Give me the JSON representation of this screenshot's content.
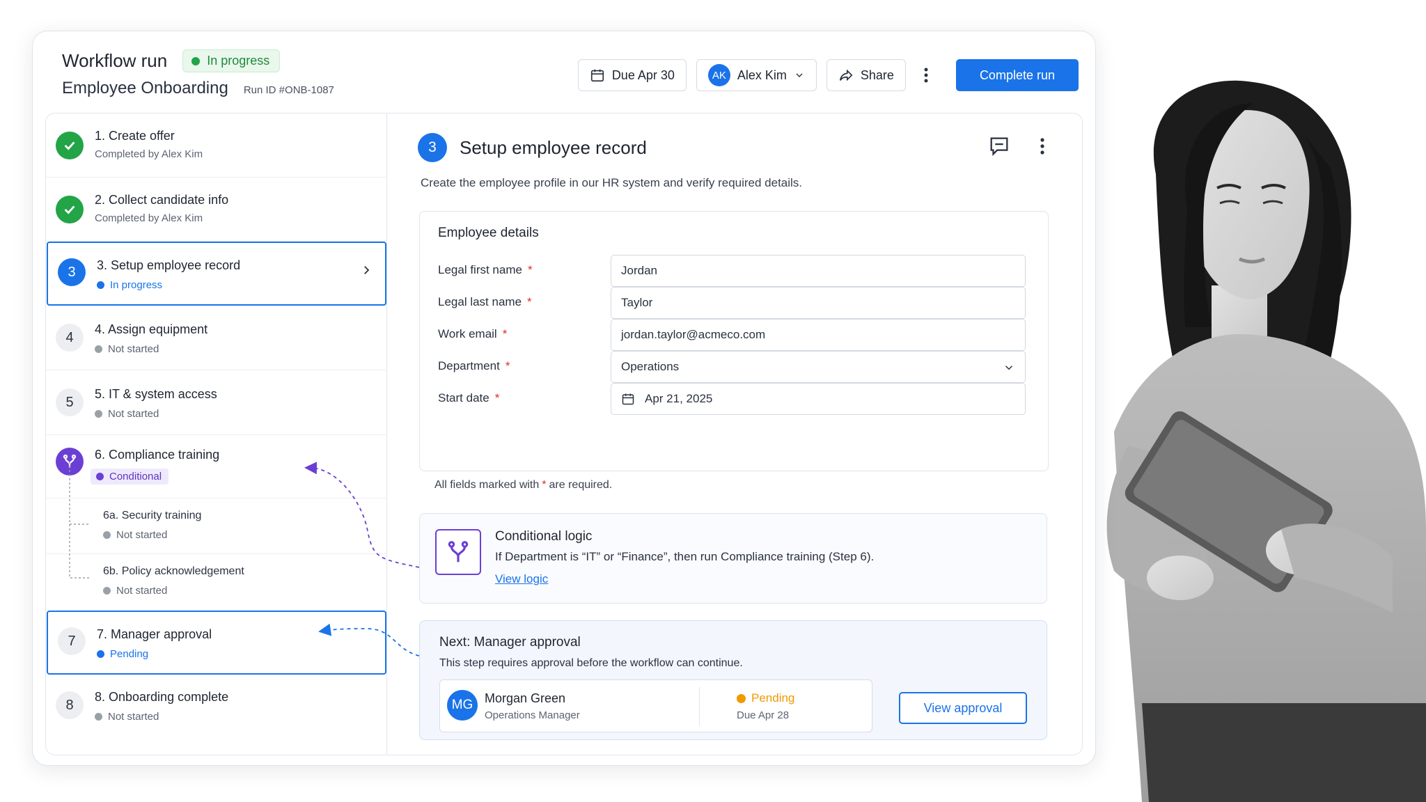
{
  "header": {
    "app_title": "Workflow run",
    "status": "In progress",
    "workflow_name": "Employee Onboarding",
    "run_id": "Run ID #ONB-1087",
    "due_label": "Due Apr 30",
    "assignee_initials": "AK",
    "assignee_name": "Alex Kim",
    "share_label": "Share",
    "complete_label": "Complete run"
  },
  "steps": [
    {
      "number": "1",
      "label": "1. Create offer",
      "meta": "Completed by Alex Kim",
      "state": "done"
    },
    {
      "number": "2",
      "label": "2. Collect candidate info",
      "meta": "Completed by Alex Kim",
      "state": "done"
    },
    {
      "number": "3",
      "label": "3. Setup employee record",
      "meta": "In progress",
      "state": "current"
    },
    {
      "number": "4",
      "label": "4. Assign equipment",
      "meta": "Not started",
      "state": "todo"
    },
    {
      "number": "5",
      "label": "5. IT & system access",
      "meta": "Not started",
      "state": "todo"
    },
    {
      "number": "6",
      "label": "6. Compliance training",
      "meta": "Conditional",
      "state": "conditional"
    },
    {
      "number": "7",
      "label": "7. Manager approval",
      "meta": "Pending",
      "state": "pending"
    },
    {
      "number": "8",
      "label": "8. Onboarding complete",
      "meta": "Not started",
      "state": "todo"
    }
  ],
  "sub_steps": [
    {
      "label": "6a. Security training",
      "meta": "Not started"
    },
    {
      "label": "6b. Policy acknowledgement",
      "meta": "Not started"
    }
  ],
  "main": {
    "step_number": "3",
    "title": "Setup employee record",
    "description": "Create the employee profile in our HR system and verify required details.",
    "card_title": "Employee details",
    "fields": [
      {
        "label": "Legal first name",
        "value": "Jordan"
      },
      {
        "label": "Legal last name",
        "value": "Taylor"
      },
      {
        "label": "Work email",
        "value": "jordan.taylor@acmeco.com"
      },
      {
        "label": "Department",
        "value": "Operations"
      },
      {
        "label": "Start date",
        "value": "Apr 21, 2025"
      }
    ],
    "required_marker": "*",
    "required_note_prefix": "All fields marked with",
    "required_note_suffix": "are required."
  },
  "logic": {
    "title": "Conditional logic",
    "text": "If Department is “IT” or “Finance”, then run Compliance training (Step 6).",
    "link": "View logic"
  },
  "next": {
    "title": "Next: Manager approval",
    "description": "This step requires approval before the workflow can continue.",
    "approver_initials": "MG",
    "approver_name": "Morgan Green",
    "approver_role": "Operations Manager",
    "status": "Pending",
    "due": "Due Apr 28",
    "button": "View approval"
  },
  "colors": {
    "accent": "#1a73e8",
    "success": "#22a447",
    "conditional": "#6b3fd4",
    "pending": "#f29900",
    "required": "#d93025"
  }
}
